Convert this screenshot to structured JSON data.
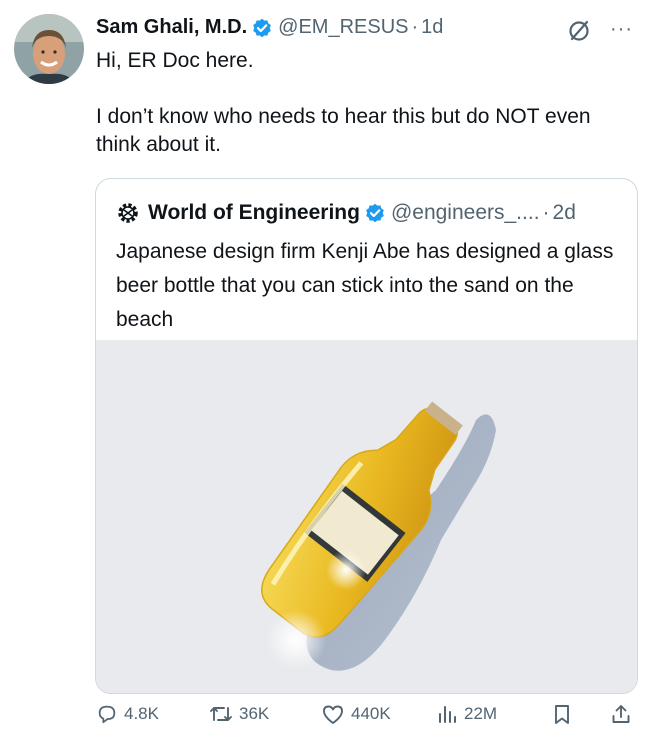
{
  "tweet": {
    "author_name": "Sam Ghali, M.D.",
    "handle": "@EM_RESUS",
    "separator": "·",
    "time": "1d",
    "more": "···",
    "text_line1": "Hi, ER Doc here.",
    "text_line2": "I don’t know who needs to hear this but do NOT even think about it."
  },
  "quote": {
    "author_name": "World of Engineering",
    "handle": "@engineers_....",
    "separator": "·",
    "time": "2d",
    "text": "Japanese design firm Kenji Abe has designed a glass beer bottle that you can stick into the sand on the beach"
  },
  "actions": {
    "replies": "4.8K",
    "reposts": "36K",
    "likes": "440K",
    "views": "22M"
  },
  "colors": {
    "text": "#0f1419",
    "secondary": "#536471",
    "verified": "#1d9bf0",
    "border": "#cfd9de",
    "media_bg": "#e9eaee",
    "beer": "#e9b820"
  }
}
